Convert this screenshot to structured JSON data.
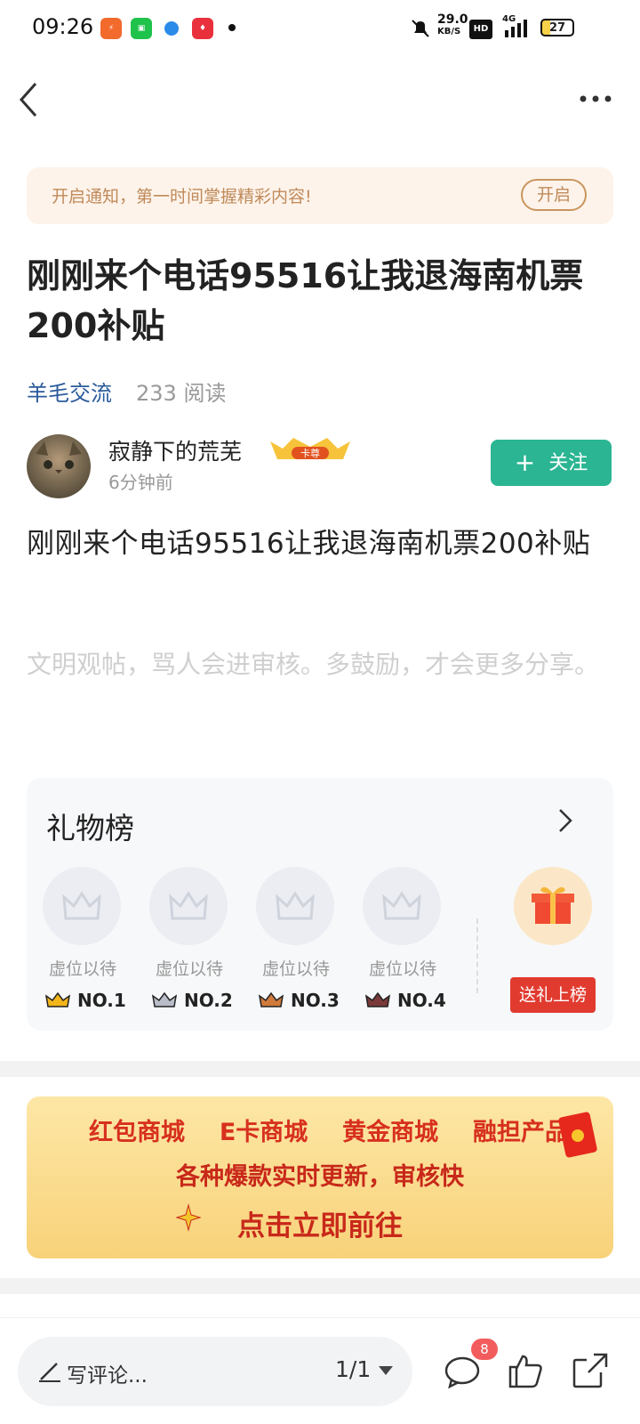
{
  "status_bar": {
    "time": "09:26",
    "net_speed_value": "29.0",
    "net_speed_unit": "KB/S",
    "hd": "HD",
    "signal_type": "4G",
    "battery": "27",
    "app_icons": [
      "app-icon-1",
      "app-icon-2",
      "app-icon-3",
      "app-icon-4"
    ]
  },
  "nav": {
    "back_icon": "back-arrow-icon",
    "more_icon": "more-dots-icon"
  },
  "notify": {
    "text": "开启通知，第一时间掌握精彩内容!",
    "button": "开启"
  },
  "post": {
    "title": "刚刚来个电话95516让我退海南机票200补贴",
    "category": "羊毛交流",
    "reads": "233 阅读",
    "author": "寂静下的荒芜",
    "author_badge": "卡尊",
    "time_ago": "6分钟前",
    "follow": "关注",
    "body": "刚刚来个电话95516让我退海南机票200补贴",
    "notice": "文明观帖，骂人会进审核。多鼓励，才会更多分享。"
  },
  "gift_board": {
    "title": "礼物榜",
    "slots": [
      {
        "label": "虚位以待",
        "rank": "NO.1",
        "crown_color": "#f2b51b"
      },
      {
        "label": "虚位以待",
        "rank": "NO.2",
        "crown_color": "#8a8fa0"
      },
      {
        "label": "虚位以待",
        "rank": "NO.3",
        "crown_color": "#d07a3c"
      },
      {
        "label": "虚位以待",
        "rank": "NO.4",
        "crown_color": "#7a3a3a"
      }
    ],
    "send_button": "送礼上榜"
  },
  "banner": {
    "items": [
      "红包商城",
      "E卡商城",
      "黄金商城",
      "融担产品"
    ],
    "line2": "各种爆款实时更新，审核快",
    "line3": "点击立即前往"
  },
  "bottom_bar": {
    "comment_placeholder": "写评论...",
    "page": "1/1",
    "comment_count": "8"
  },
  "colors": {
    "accent": "#2bb593",
    "link": "#2b5b9c",
    "red": "#e13b30"
  }
}
